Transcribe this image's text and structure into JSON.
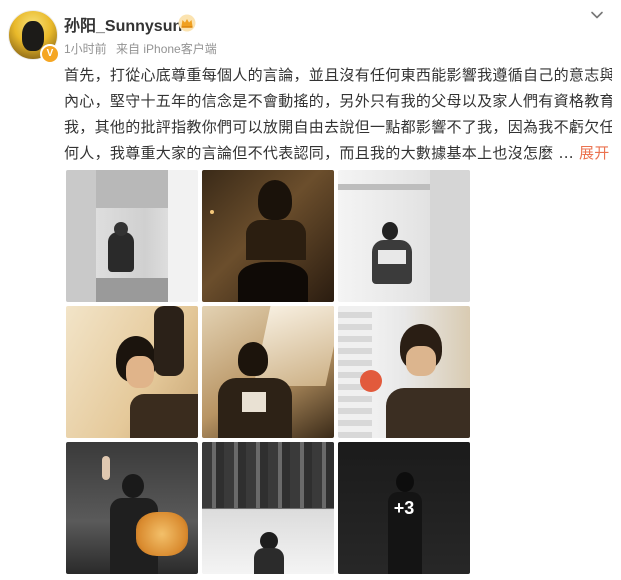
{
  "author": {
    "name": "孙阳_Sunnysun",
    "verified_mark": "V"
  },
  "meta": {
    "time": "1小时前",
    "source": "来自 iPhone客户端"
  },
  "post": {
    "lines": [
      "首先，打從心底尊重每個人的言論，並且沒有任何東西能影響我遵循自己的意志與",
      "內心，堅守十五年的信念是不會動搖的，另外只有我的父母以及家人們有資格教育",
      "我，其他的批評指教你們可以放開自由去說但一點都影響不了我，因為我不虧欠任",
      "何人，我尊重大家的言論但不代表認同，而且我的大數據基本上也沒怎麼 ..."
    ],
    "expand_label": "展开"
  },
  "images": {
    "more_count": "+3"
  },
  "icons": {
    "crown": "crown-icon",
    "chevron": "chevron-down-icon",
    "verified": "verified-badge-icon"
  },
  "colors": {
    "accent": "#eb7350",
    "meta_text": "#939393",
    "verified": "#f5a623"
  }
}
